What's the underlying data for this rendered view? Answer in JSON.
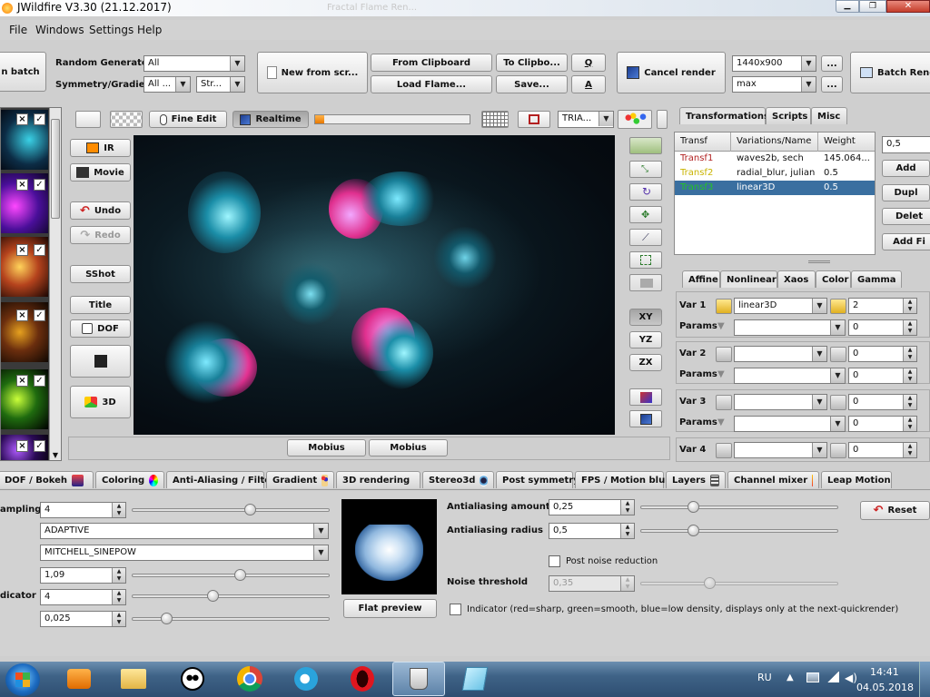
{
  "window": {
    "title": "JWildfire V3.30 (21.12.2017)",
    "ghost_title": "Fractal Flame Ren..."
  },
  "menu": [
    "File",
    "Windows",
    "Settings",
    "Help"
  ],
  "toolbar": {
    "batch_label": "n batch",
    "random_generator_label": "Random Generator",
    "random_generator_value": "All",
    "symmetry_label": "Symmetry/Gradient",
    "symmetry_value": "All ...",
    "gradient_value": "Str...",
    "new_from_script": "New from scr...",
    "from_clipboard": "From Clipboard",
    "to_clipboard": "To Clipbo...",
    "load_flame": "Load Flame...",
    "save": "Save...",
    "q_label": "Q",
    "a_label": "A",
    "cancel_render": "Cancel render",
    "resolution": "1440x900",
    "quality": "max",
    "more": "...",
    "batch_render": "Batch Rend"
  },
  "preview_toolbar": {
    "fine_edit": "Fine Edit",
    "realtime": "Realtime",
    "progress": 0.06,
    "triangle_mode": "TRIA..."
  },
  "left_tools": {
    "ir": "IR",
    "movie": "Movie",
    "undo": "Undo",
    "redo": "Redo",
    "sshot": "SShot",
    "title": "Title",
    "dof": "DOF",
    "three_d": "3D"
  },
  "axis_buttons": [
    "XY",
    "YZ",
    "ZX"
  ],
  "mobius": [
    "Mobius",
    "Mobius"
  ],
  "right_tabs": [
    "Transformations",
    "Scripts",
    "Misc"
  ],
  "transforms": {
    "headers": [
      "Transf",
      "Variations/Name",
      "Weight"
    ],
    "rows": [
      {
        "name": "Transf1",
        "variations": "waves2b, sech",
        "weight": "145.064...",
        "color": "#b22222"
      },
      {
        "name": "Transf2",
        "variations": "radial_blur, julian",
        "weight": "0.5",
        "color": "#c9b400"
      },
      {
        "name": "Transf3",
        "variations": "linear3D",
        "weight": "0.5",
        "color": "#24c424"
      }
    ],
    "weight_input": "0,5",
    "add": "Add",
    "dupl": "Dupl",
    "delete": "Delet",
    "add_final": "Add Fi"
  },
  "sub_tabs": [
    "Affine",
    "Nonlinear",
    "Xaos",
    "Color",
    "Gamma"
  ],
  "variations": [
    {
      "label": "Var 1",
      "value": "linear3D",
      "amount": "2",
      "params_label": "Params",
      "params_value": "",
      "param_amount": "0"
    },
    {
      "label": "Var 2",
      "value": "",
      "amount": "0",
      "params_label": "Params",
      "params_value": "",
      "param_amount": "0"
    },
    {
      "label": "Var 3",
      "value": "",
      "amount": "0",
      "params_label": "Params",
      "params_value": "",
      "param_amount": "0"
    },
    {
      "label": "Var 4",
      "value": "",
      "amount": "0"
    }
  ],
  "bottom_tabs": [
    "DOF / Bokeh",
    "Coloring",
    "Anti-Aliasing / Filter",
    "Gradient",
    "3D rendering",
    "Stereo3d",
    "Post symmetry",
    "FPS / Motion blur",
    "Layers",
    "Channel mixer",
    "Leap Motion"
  ],
  "aa": {
    "oversampling_label": "ampling",
    "oversampling_value": "4",
    "kernel_type": "ADAPTIVE",
    "kernel_name": "MITCHELL_SINEPOW",
    "radius_value": "1,09",
    "indicator_label": "dicator",
    "indicator_value": "4",
    "third_value": "0,025",
    "flat_preview": "Flat preview",
    "aa_amount_label": "Antialiasing amount",
    "aa_amount_value": "0,25",
    "aa_radius_label": "Antialiasing radius",
    "aa_radius_value": "0,5",
    "post_noise": "Post noise reduction",
    "noise_threshold_label": "Noise threshold",
    "noise_threshold_value": "0,35",
    "indicator_text": "Indicator (red=sharp, green=smooth, blue=low density, displays only at the next-quickrender)",
    "reset": "Reset"
  },
  "taskbar": {
    "lang": "RU",
    "time": "14:41",
    "date": "04.05.2018"
  }
}
